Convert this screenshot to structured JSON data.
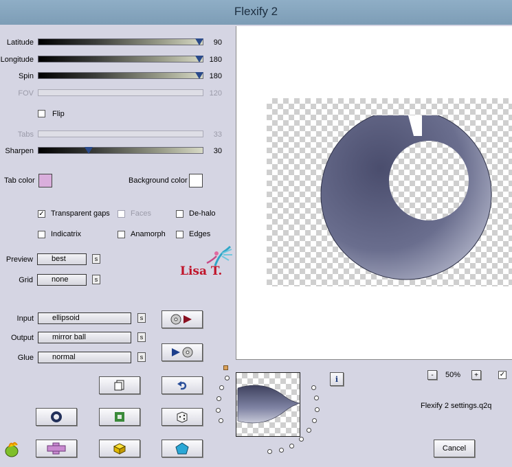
{
  "window": {
    "title": "Flexify 2"
  },
  "sliders": {
    "latitude": {
      "label": "Latitude",
      "value": "90",
      "level": 1.0
    },
    "longitude": {
      "label": "Longitude",
      "value": "180",
      "level": 1.0
    },
    "spin": {
      "label": "Spin",
      "value": "180",
      "level": 1.0
    },
    "fov": {
      "label": "FOV",
      "value": "120"
    },
    "tabs": {
      "label": "Tabs",
      "value": "33"
    },
    "sharpen": {
      "label": "Sharpen",
      "value": "30",
      "level": 0.3
    }
  },
  "flip": {
    "label": "Flip",
    "checked": false
  },
  "colors": {
    "tab_label": "Tab color",
    "tab_color": "#d9aedc",
    "background_label": "Background color",
    "background_color": "#ffffff"
  },
  "options": {
    "transparent_gaps": {
      "label": "Transparent gaps",
      "checked": true
    },
    "faces": {
      "label": "Faces",
      "checked": false
    },
    "de_halo": {
      "label": "De-halo",
      "checked": false
    },
    "indicatrix": {
      "label": "Indicatrix",
      "checked": false
    },
    "anamorph": {
      "label": "Anamorph",
      "checked": false
    },
    "edges": {
      "label": "Edges",
      "checked": false
    }
  },
  "preview_select": {
    "label": "Preview",
    "value": "best",
    "s": "s"
  },
  "grid_select": {
    "label": "Grid",
    "value": "none",
    "s": "s"
  },
  "watermark": {
    "text": "Lisa T."
  },
  "projection": {
    "input": {
      "label": "Input",
      "value": "ellipsoid",
      "s": "s"
    },
    "output": {
      "label": "Output",
      "value": "mirror ball",
      "s": "s"
    },
    "glue": {
      "label": "Glue",
      "value": "normal",
      "s": "s"
    }
  },
  "zoom": {
    "minus": "-",
    "value": "50%",
    "plus": "+",
    "check": "✓"
  },
  "info_button": "i",
  "settings_file": "Flexify 2 settings.q2q",
  "cancel_label": "Cancel",
  "check_mark": "✓",
  "icons": {
    "copy": "copy-icon",
    "undo": "undo-icon",
    "ring": "ring-icon",
    "frame": "square-frame-icon",
    "dice": "dice-icon",
    "cross": "cross-icon",
    "cube": "cube-icon",
    "pentagon": "pentagon-icon",
    "logo": "flaming-pear-logo-icon"
  }
}
